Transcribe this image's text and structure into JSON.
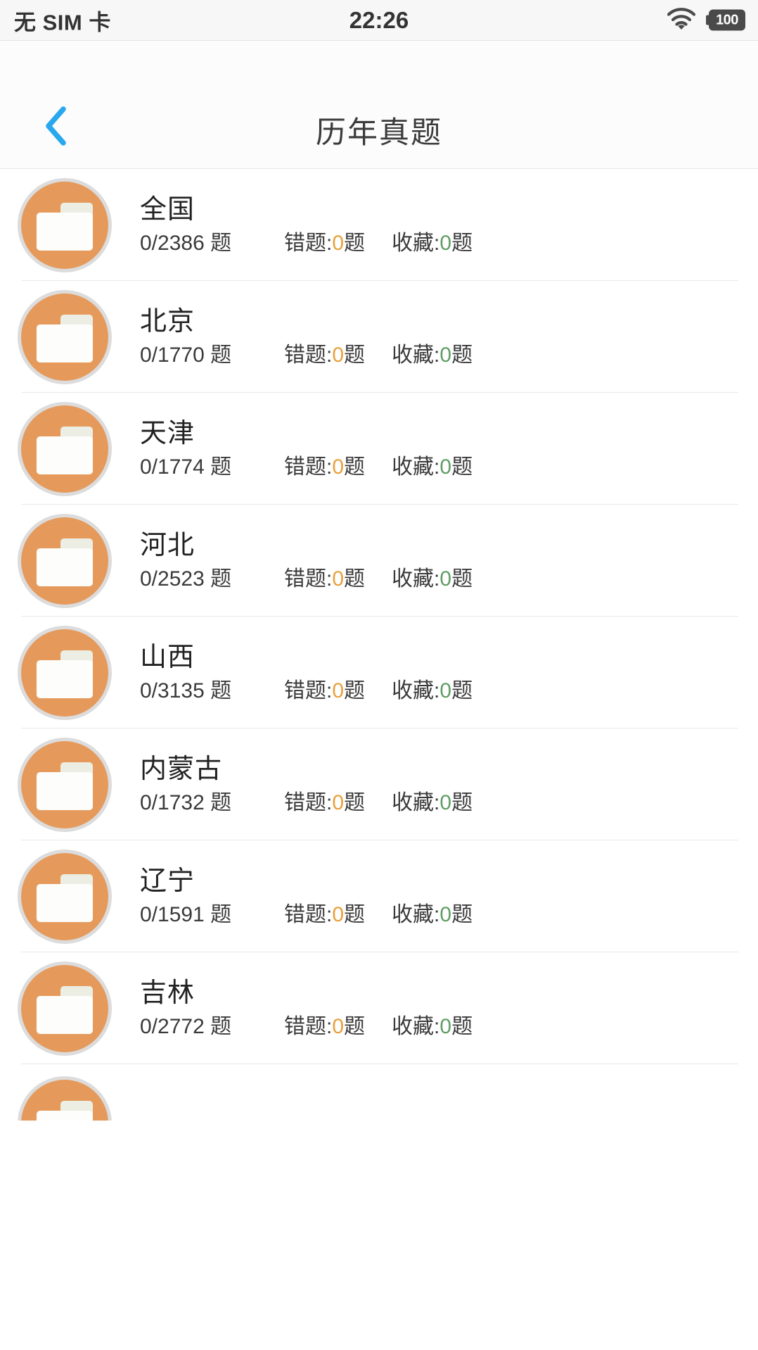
{
  "status_bar": {
    "carrier": "无 SIM 卡",
    "time": "22:26",
    "wifi_icon": "wifi-icon",
    "battery_level": "100"
  },
  "nav_bar": {
    "back_icon": "chevron-left-icon",
    "title": "历年真题",
    "accent_color": "#29a8ee"
  },
  "colors": {
    "folder_orange": "#e59a5c",
    "folder_ring": "#dcdcdc",
    "wrong_number": "#e8a13c",
    "fav_number": "#5f9e63",
    "divider": "#e8e8e8"
  },
  "labels": {
    "wrong_prefix": "错题:",
    "wrong_suffix": "题",
    "fav_prefix": "收藏:",
    "fav_suffix": "题",
    "total_suffix": " 题"
  },
  "list": {
    "items": [
      {
        "name": "全国",
        "total": "0/2386 题",
        "wrong_label": "错题:",
        "wrong": "0",
        "wrong_unit": "题",
        "fav_label": "收藏:",
        "fav": "0",
        "fav_unit": "题",
        "icon": "folder-icon"
      },
      {
        "name": "北京",
        "total": "0/1770 题",
        "wrong_label": "错题:",
        "wrong": "0",
        "wrong_unit": "题",
        "fav_label": "收藏:",
        "fav": "0",
        "fav_unit": "题",
        "icon": "folder-icon"
      },
      {
        "name": "天津",
        "total": "0/1774 题",
        "wrong_label": "错题:",
        "wrong": "0",
        "wrong_unit": "题",
        "fav_label": "收藏:",
        "fav": "0",
        "fav_unit": "题",
        "icon": "folder-icon"
      },
      {
        "name": "河北",
        "total": "0/2523 题",
        "wrong_label": "错题:",
        "wrong": "0",
        "wrong_unit": "题",
        "fav_label": "收藏:",
        "fav": "0",
        "fav_unit": "题",
        "icon": "folder-icon"
      },
      {
        "name": "山西",
        "total": "0/3135 题",
        "wrong_label": "错题:",
        "wrong": "0",
        "wrong_unit": "题",
        "fav_label": "收藏:",
        "fav": "0",
        "fav_unit": "题",
        "icon": "folder-icon"
      },
      {
        "name": "内蒙古",
        "total": "0/1732 题",
        "wrong_label": "错题:",
        "wrong": "0",
        "wrong_unit": "题",
        "fav_label": "收藏:",
        "fav": "0",
        "fav_unit": "题",
        "icon": "folder-icon"
      },
      {
        "name": "辽宁",
        "total": "0/1591 题",
        "wrong_label": "错题:",
        "wrong": "0",
        "wrong_unit": "题",
        "fav_label": "收藏:",
        "fav": "0",
        "fav_unit": "题",
        "icon": "folder-icon"
      },
      {
        "name": "吉林",
        "total": "0/2772 题",
        "wrong_label": "错题:",
        "wrong": "0",
        "wrong_unit": "题",
        "fav_label": "收藏:",
        "fav": "0",
        "fav_unit": "题",
        "icon": "folder-icon"
      }
    ]
  }
}
